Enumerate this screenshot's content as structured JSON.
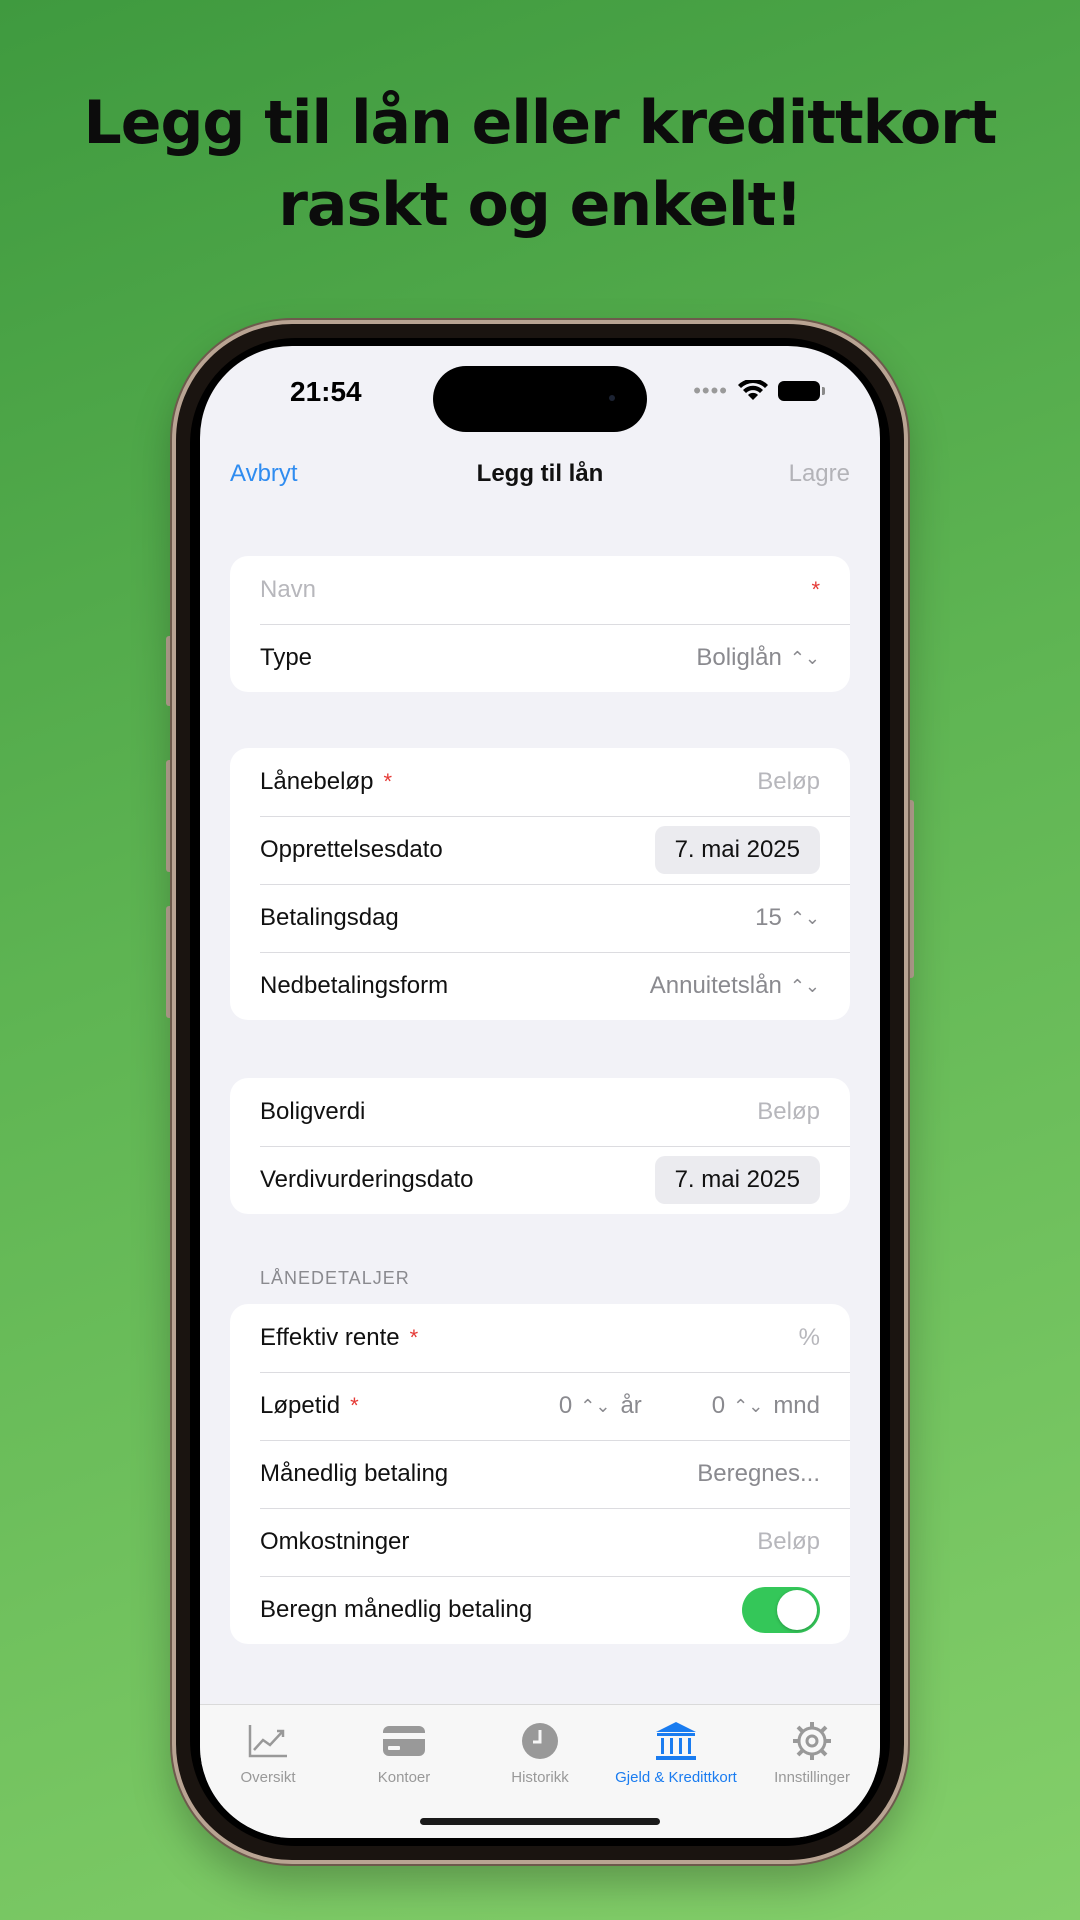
{
  "headline": {
    "line1": "Legg til lån eller kredittkort",
    "line2": "raskt og enkelt!"
  },
  "status_bar": {
    "time": "21:54"
  },
  "nav": {
    "cancel": "Avbryt",
    "title": "Legg til lån",
    "save": "Lagre"
  },
  "group1": {
    "name_placeholder": "Navn",
    "required_mark": "*",
    "type_label": "Type",
    "type_value": "Boliglån"
  },
  "group2": {
    "amount_label": "Lånebeløp",
    "amount_placeholder": "Beløp",
    "created_label": "Opprettelsesdato",
    "created_value": "7. mai 2025",
    "payday_label": "Betalingsdag",
    "payday_value": "15",
    "repayment_label": "Nedbetalingsform",
    "repayment_value": "Annuitetslån"
  },
  "group3": {
    "home_value_label": "Boligverdi",
    "home_value_placeholder": "Beløp",
    "valuation_label": "Verdivurderingsdato",
    "valuation_value": "7. mai 2025"
  },
  "loan_details": {
    "header": "LÅNEDETALJER",
    "rate_label": "Effektiv rente",
    "rate_placeholder": "%",
    "term_label": "Løpetid",
    "term_years": "0",
    "term_years_unit": "år",
    "term_months": "0",
    "term_months_unit": "mnd",
    "monthly_label": "Månedlig betaling",
    "monthly_value": "Beregnes...",
    "costs_label": "Omkostninger",
    "costs_placeholder": "Beløp",
    "calc_label": "Beregn månedlig betaling",
    "calc_enabled": true
  },
  "tabs": [
    {
      "label": "Oversikt",
      "icon": "chart-icon"
    },
    {
      "label": "Kontoer",
      "icon": "card-icon"
    },
    {
      "label": "Historikk",
      "icon": "clock-icon"
    },
    {
      "label": "Gjeld & Kredittkort",
      "icon": "bank-icon",
      "active": true
    },
    {
      "label": "Innstillinger",
      "icon": "gear-icon"
    }
  ],
  "colors": {
    "accent": "#1a7cf0",
    "toggle_on": "#34c759",
    "required": "#e53935"
  }
}
